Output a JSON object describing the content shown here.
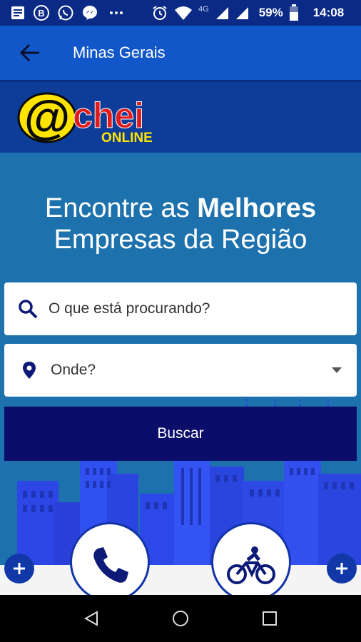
{
  "status_bar": {
    "network_label": "4G",
    "battery_percent": "59%",
    "time": "14:08",
    "icons": [
      "news-icon",
      "b-icon",
      "whatsapp-icon",
      "messenger-icon",
      "more-icon",
      "alarm-icon",
      "wifi-icon",
      "signal-icon",
      "signal-icon",
      "battery-icon"
    ]
  },
  "app_bar": {
    "title": "Minas Gerais"
  },
  "logo": {
    "at_symbol": "@",
    "word": "chei",
    "sub": "ONLINE"
  },
  "hero": {
    "headline_part1": "Encontre as ",
    "headline_bold": "Melhores",
    "headline_part2": "Empresas da Região"
  },
  "search": {
    "what_placeholder": "O que está procurando?",
    "where_placeholder": "Onde?",
    "button_label": "Buscar"
  },
  "colors": {
    "status_bar": "#0a2a86",
    "app_bar": "#1257c9",
    "hero_bg": "#1d72ad",
    "button_bg": "#0b0d6b",
    "accent": "#1334a8",
    "logo_yellow": "#ffe400",
    "logo_red": "#e01b1b"
  }
}
